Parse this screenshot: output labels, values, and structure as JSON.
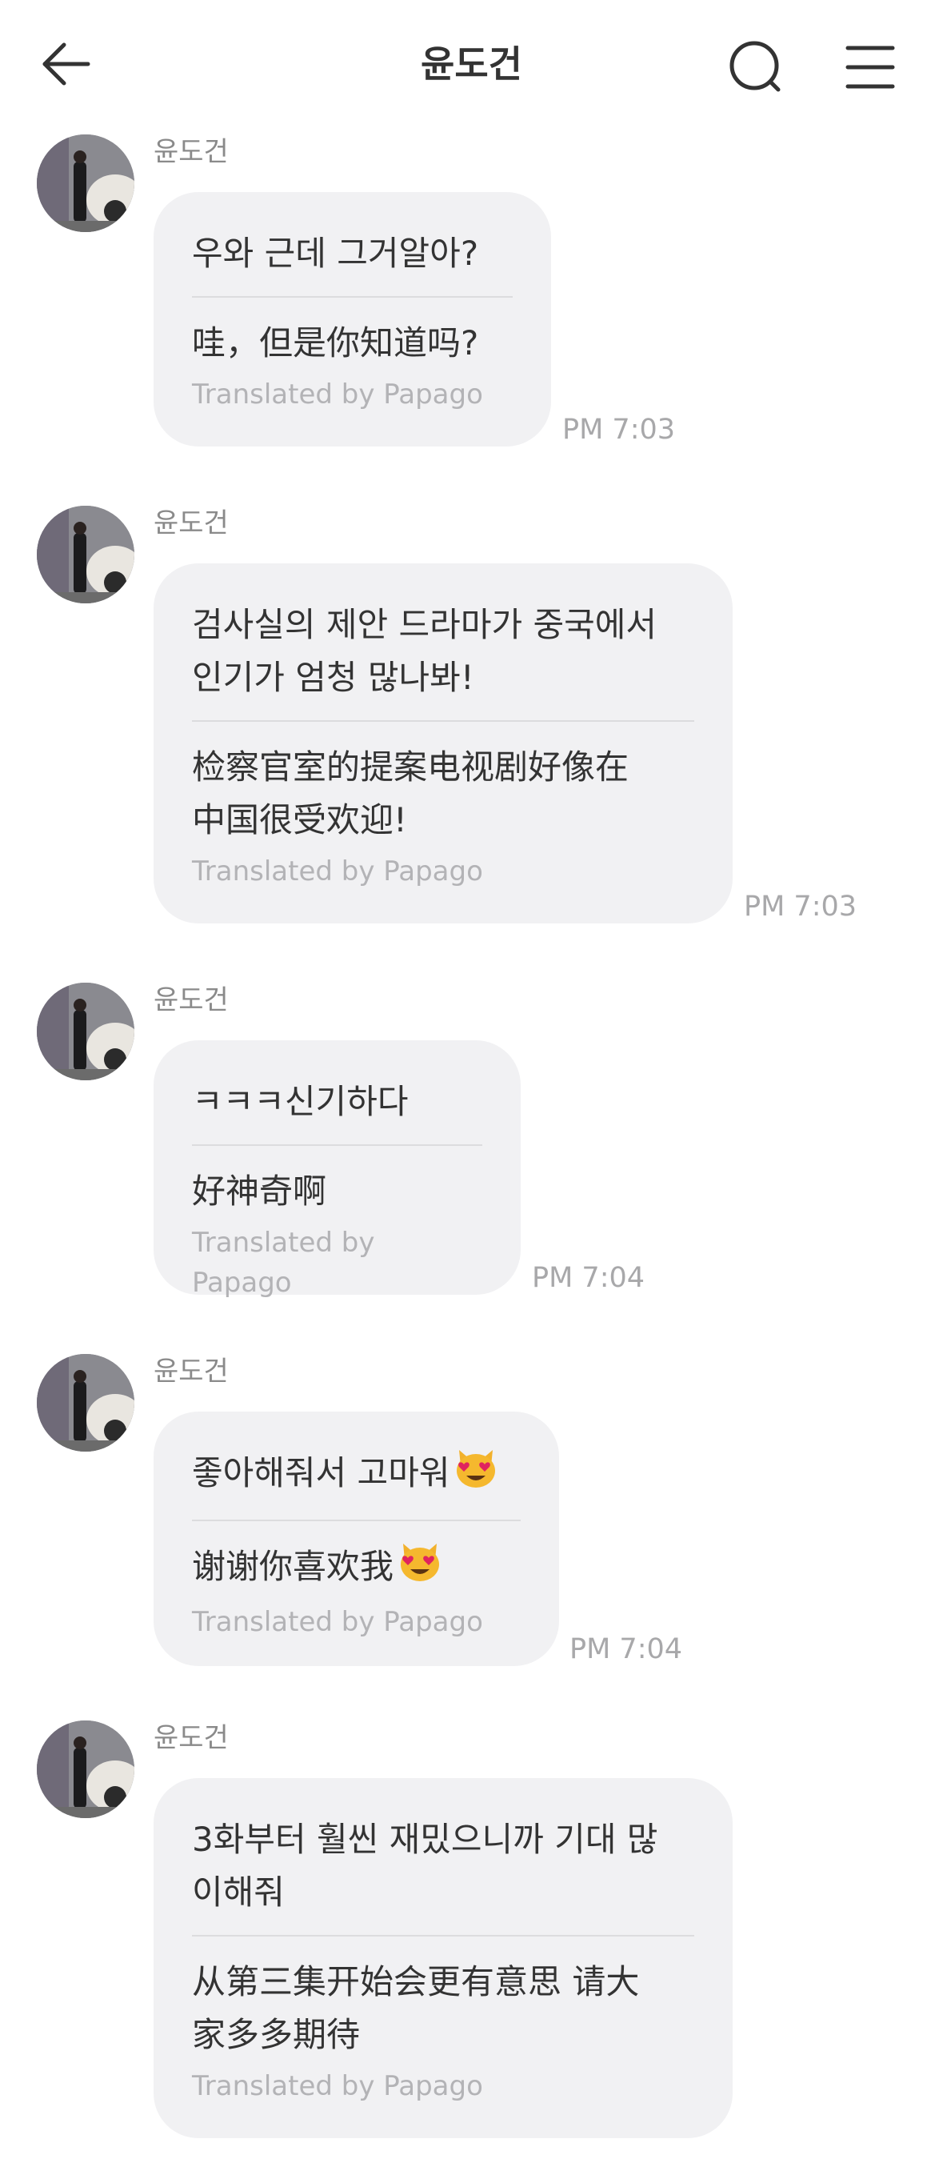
{
  "header": {
    "title": "윤도건",
    "back_icon": "back-arrow-icon",
    "search_icon": "search-icon",
    "menu_icon": "menu-icon"
  },
  "credit_text": "Translated by Papago",
  "messages": [
    {
      "sender": "윤도건",
      "original": "우와 근데 그거알아?",
      "translated": "哇，但是你知道吗?",
      "time": "PM 7:03"
    },
    {
      "sender": "윤도건",
      "original": "검사실의 제안 드라마가 중국에서\n인기가 엄청 많나봐!",
      "translated": "检察官室的提案电视剧好像在\n中国很受欢迎!",
      "time": "PM 7:03"
    },
    {
      "sender": "윤도건",
      "original": "ㅋㅋㅋ신기하다",
      "translated": "好神奇啊",
      "time": "PM 7:04"
    },
    {
      "sender": "윤도건",
      "original": "좋아해줘서 고마워",
      "translated": "谢谢你喜欢我",
      "time": "PM 7:04",
      "emoji": "heart-eyes-cat-emoji"
    },
    {
      "sender": "윤도건",
      "original": "3화부터 훨씬 재밌으니까 기대 많\n이해줘",
      "translated": "从第三集开始会更有意思 请大\n家多多期待",
      "time": ""
    }
  ],
  "colors": {
    "bubble": "#f1f1f3",
    "text": "#333333",
    "secondary": "#8a8a8a",
    "credit": "#b3b3b6"
  }
}
